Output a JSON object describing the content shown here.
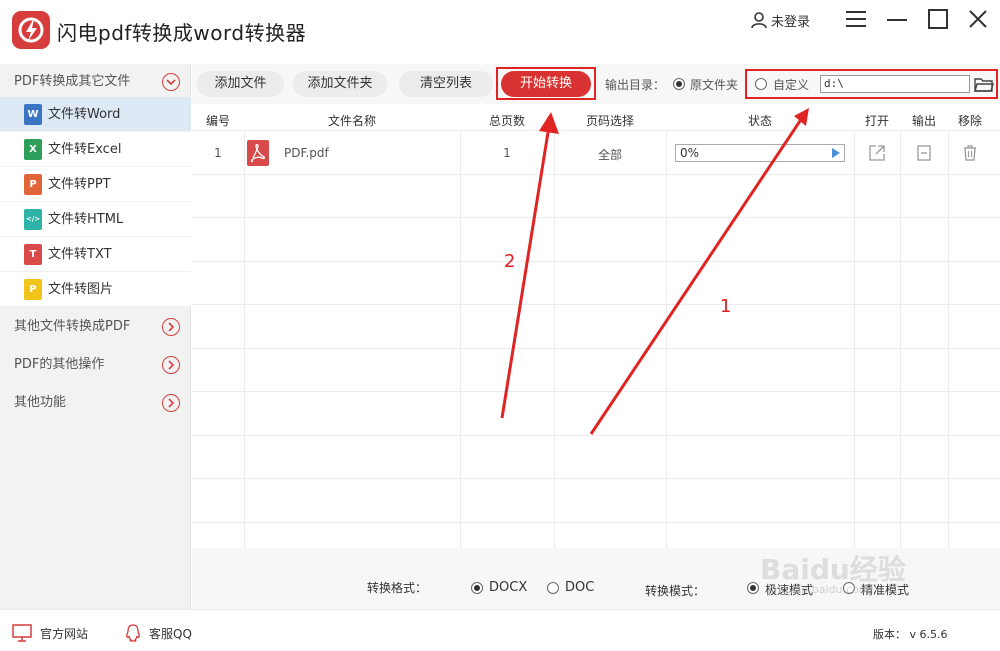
{
  "app": {
    "title": "闪电pdf转换成word转换器",
    "login_label": "未登录"
  },
  "sidebar": {
    "categories": [
      {
        "label": "PDF转换成其它文件"
      },
      {
        "label": "其他文件转换成PDF"
      },
      {
        "label": "PDF的其他操作"
      },
      {
        "label": "其他功能"
      }
    ],
    "items": [
      {
        "label": "文件转Word",
        "icon_letter": "W",
        "color": "#3a75c4"
      },
      {
        "label": "文件转Excel",
        "icon_letter": "X",
        "color": "#2e9e5b"
      },
      {
        "label": "文件转PPT",
        "icon_letter": "P",
        "color": "#e0663a"
      },
      {
        "label": "文件转HTML",
        "icon_letter": "</>",
        "color": "#2fb3a8"
      },
      {
        "label": "文件转TXT",
        "icon_letter": "T",
        "color": "#d94a4a"
      },
      {
        "label": "文件转图片",
        "icon_letter": "P",
        "color": "#f0c419"
      }
    ]
  },
  "toolbar": {
    "add_file": "添加文件",
    "add_folder": "添加文件夹",
    "clear_list": "清空列表",
    "start_convert": "开始转换",
    "output_dir_label": "输出目录：",
    "option_source_folder": "原文件夹",
    "option_custom": "自定义",
    "custom_path": "d:\\"
  },
  "table": {
    "headers": [
      "编号",
      "文件名称",
      "总页数",
      "页码选择",
      "状态",
      "打开",
      "输出",
      "移除"
    ],
    "rows": [
      {
        "index": "1",
        "filename": "PDF.pdf",
        "pages": "1",
        "page_select": "全部",
        "progress": "0%"
      }
    ]
  },
  "bottom": {
    "format_label": "转换格式：",
    "format_options": [
      "DOCX",
      "DOC"
    ],
    "format_selected": "DOCX",
    "mode_label": "转换模式：",
    "mode_options": [
      "极速模式",
      "精准模式"
    ]
  },
  "footer": {
    "website": "官方网站",
    "qq": "客服QQ",
    "version": "版本： v 6.5.6"
  },
  "annotations": {
    "label_1": "1",
    "label_2": "2"
  },
  "watermark": {
    "text": "Baidu经验",
    "url": "jingyan.baidu.com"
  },
  "colors": {
    "accent": "#d93232",
    "annotation": "#e02424",
    "selected_item_bg": "#dde9f5"
  }
}
